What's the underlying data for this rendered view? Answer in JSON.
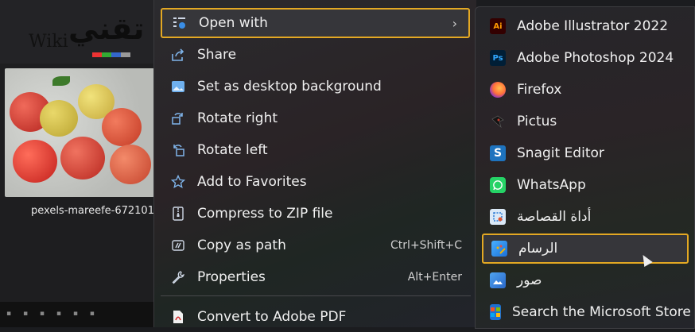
{
  "background": {
    "logo": {
      "arabic": "تقني",
      "latin": "Wiki"
    },
    "thumbnail_filename": "pexels-mareefe-672101"
  },
  "context_menu": {
    "items": [
      {
        "label": "Open with",
        "icon": "open-with-icon",
        "shortcut": "",
        "submenu": true
      },
      {
        "label": "Share",
        "icon": "share-icon",
        "shortcut": ""
      },
      {
        "label": "Set as desktop background",
        "icon": "desktop-background-icon",
        "shortcut": ""
      },
      {
        "label": "Rotate right",
        "icon": "rotate-right-icon",
        "shortcut": ""
      },
      {
        "label": "Rotate left",
        "icon": "rotate-left-icon",
        "shortcut": ""
      },
      {
        "label": "Add to Favorites",
        "icon": "star-icon",
        "shortcut": ""
      },
      {
        "label": "Compress to ZIP file",
        "icon": "zip-icon",
        "shortcut": ""
      },
      {
        "label": "Copy as path",
        "icon": "copy-path-icon",
        "shortcut": "Ctrl+Shift+C"
      },
      {
        "label": "Properties",
        "icon": "wrench-icon",
        "shortcut": "Alt+Enter"
      },
      {
        "label": "Convert to Adobe PDF",
        "icon": "adobe-pdf-icon",
        "shortcut": ""
      }
    ]
  },
  "open_with_submenu": {
    "items": [
      {
        "label": "Adobe Illustrator 2022",
        "icon": "adobe-illustrator-icon",
        "badge": "Ai",
        "color": "#ff9a00",
        "bg": "#330000"
      },
      {
        "label": "Adobe Photoshop 2024",
        "icon": "adobe-photoshop-icon",
        "badge": "Ps",
        "color": "#31a8ff",
        "bg": "#001e36"
      },
      {
        "label": "Firefox",
        "icon": "firefox-icon",
        "badge": "",
        "color": "#ff7139",
        "bg": "#7a2bd8"
      },
      {
        "label": "Pictus",
        "icon": "pictus-icon",
        "badge": "",
        "color": "#c0392b",
        "bg": "#1b1b1b"
      },
      {
        "label": "Snagit Editor",
        "icon": "snagit-icon",
        "badge": "S",
        "color": "#ffffff",
        "bg": "#1e73be"
      },
      {
        "label": "WhatsApp",
        "icon": "whatsapp-icon",
        "badge": "",
        "color": "#ffffff",
        "bg": "#25d366"
      },
      {
        "label": "أداة القصاصة",
        "icon": "snipping-tool-icon",
        "badge": "",
        "color": "#2b7bd6",
        "bg": "#dbe9f7"
      },
      {
        "label": "الرسام",
        "icon": "paint-icon",
        "badge": "",
        "color": "#f5b400",
        "bg": "#2b8be0"
      },
      {
        "label": "صور",
        "icon": "photos-icon",
        "badge": "",
        "color": "#ffffff",
        "bg": "#2a7fd4"
      },
      {
        "label": "Search the Microsoft Store",
        "icon": "microsoft-store-icon",
        "badge": "",
        "color": "#ffffff",
        "bg": "#1d6fd1"
      }
    ]
  },
  "colors": {
    "highlight_border": "#e3a823",
    "menu_text": "#f0f0f0"
  }
}
